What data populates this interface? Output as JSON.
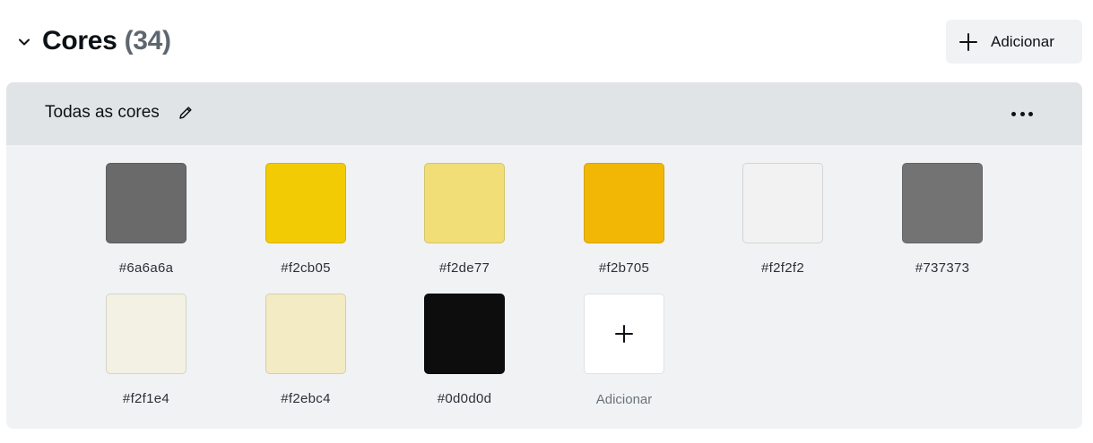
{
  "section": {
    "title": "Cores",
    "count": "(34)",
    "add_button_label": "Adicionar"
  },
  "panel": {
    "title": "Todas as cores"
  },
  "colors": [
    {
      "hex": "#6a6a6a"
    },
    {
      "hex": "#f2cb05"
    },
    {
      "hex": "#f2de77"
    },
    {
      "hex": "#f2b705"
    },
    {
      "hex": "#f2f2f2"
    },
    {
      "hex": "#737373"
    },
    {
      "hex": "#f2f1e4"
    },
    {
      "hex": "#f2ebc4"
    },
    {
      "hex": "#0d0d0d"
    }
  ],
  "add_tile_label": "Adicionar",
  "icons": {
    "collapse": "chevron-down-icon",
    "add": "plus-icon",
    "edit": "pencil-icon",
    "more": "more-horizontal-icon"
  }
}
